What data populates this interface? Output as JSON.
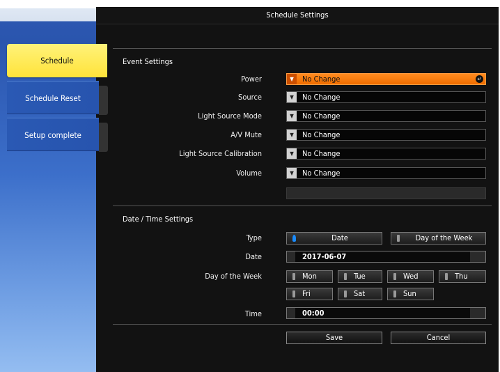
{
  "window": {
    "title": "Schedule Settings"
  },
  "sidebar": {
    "tabs": [
      {
        "label": "Schedule",
        "active": true
      },
      {
        "label": "Schedule Reset",
        "active": false
      },
      {
        "label": "Setup complete",
        "active": false
      }
    ]
  },
  "event_settings": {
    "title": "Event Settings",
    "rows": [
      {
        "label": "Power",
        "value": "No Change",
        "highlighted": true
      },
      {
        "label": "Source",
        "value": "No Change"
      },
      {
        "label": "Light Source Mode",
        "value": "No Change"
      },
      {
        "label": "A/V Mute",
        "value": "No Change"
      },
      {
        "label": "Light Source Calibration",
        "value": "No Change"
      },
      {
        "label": "Volume",
        "value": "No Change"
      }
    ]
  },
  "datetime_settings": {
    "title": "Date / Time Settings",
    "type_label": "Type",
    "type_options": [
      "Date",
      "Day of the Week"
    ],
    "type_selected": "Date",
    "date_label": "Date",
    "date_value": "2017-06-07",
    "dow_label": "Day of the Week",
    "days": [
      "Mon",
      "Tue",
      "Wed",
      "Thu",
      "Fri",
      "Sat",
      "Sun"
    ],
    "time_label": "Time",
    "time_value": "00:00"
  },
  "actions": {
    "save": "Save",
    "cancel": "Cancel"
  },
  "colors": {
    "accent": "#f07a10",
    "active_tab": "#ffe84a",
    "sidebar_blue": "#2c57b0",
    "panel": "#121212"
  }
}
